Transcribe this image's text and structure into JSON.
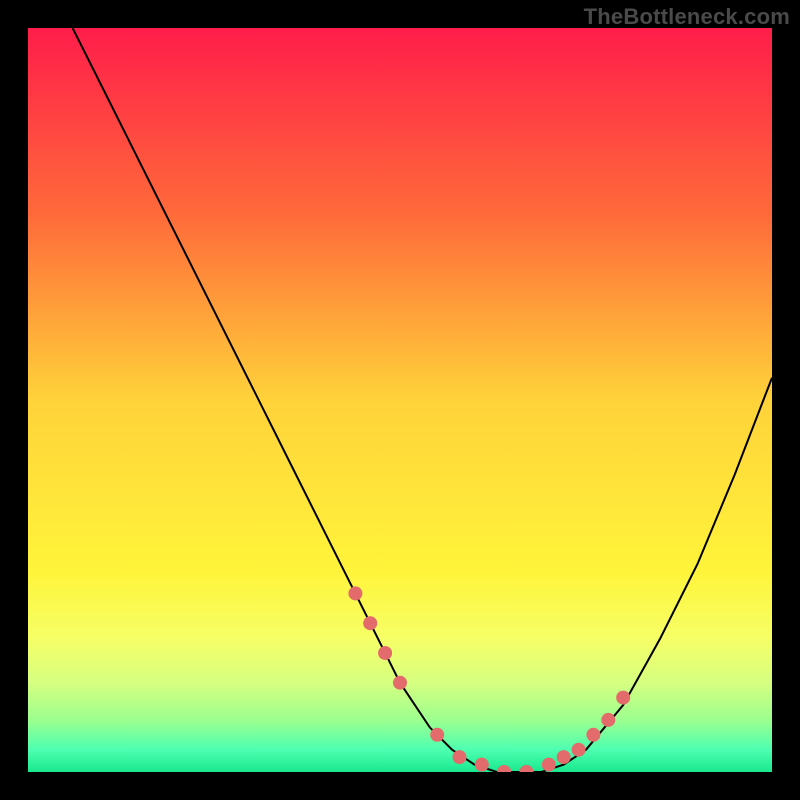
{
  "watermark": {
    "text": "TheBottleneck.com"
  },
  "chart_data": {
    "type": "line",
    "title": "",
    "xlabel": "",
    "ylabel": "",
    "xlim": [
      0,
      100
    ],
    "ylim": [
      0,
      100
    ],
    "grid": false,
    "series": [
      {
        "name": "bottleneck-curve",
        "x": [
          6,
          10,
          15,
          20,
          25,
          30,
          35,
          40,
          45,
          50,
          54,
          57,
          60,
          63,
          66,
          69,
          72,
          75,
          80,
          85,
          90,
          95,
          100
        ],
        "y": [
          100,
          92,
          82,
          72,
          62,
          52,
          42,
          32,
          22,
          12,
          6,
          3,
          1,
          0,
          0,
          0,
          1,
          3,
          9,
          18,
          28,
          40,
          53
        ]
      }
    ],
    "markers": {
      "name": "highlight-points",
      "color": "#e36b6b",
      "x": [
        44,
        46,
        48,
        50,
        55,
        58,
        61,
        64,
        67,
        70,
        72,
        74,
        76,
        78,
        80
      ],
      "y": [
        24,
        20,
        16,
        12,
        5,
        2,
        1,
        0,
        0,
        1,
        2,
        3,
        5,
        7,
        10
      ]
    },
    "background": {
      "gradient_stops": [
        {
          "offset": 0.0,
          "color": "#ff1d4a"
        },
        {
          "offset": 0.25,
          "color": "#ff6a3a"
        },
        {
          "offset": 0.5,
          "color": "#ffd23a"
        },
        {
          "offset": 0.73,
          "color": "#fff43a"
        },
        {
          "offset": 0.82,
          "color": "#f6ff66"
        },
        {
          "offset": 0.88,
          "color": "#d6ff80"
        },
        {
          "offset": 0.93,
          "color": "#9cff8f"
        },
        {
          "offset": 0.97,
          "color": "#4dffb0"
        },
        {
          "offset": 1.0,
          "color": "#19e88f"
        }
      ]
    }
  }
}
